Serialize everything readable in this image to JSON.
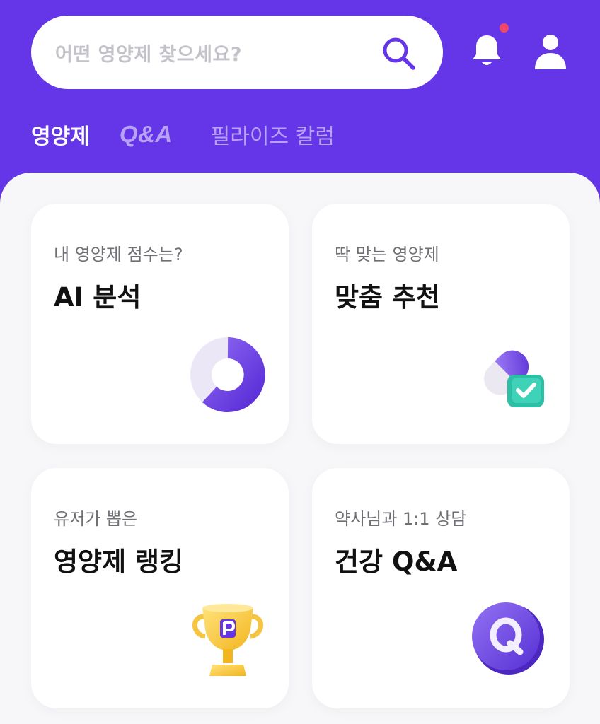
{
  "search": {
    "placeholder": "어떤 영양제 찾으세요?"
  },
  "header_icons": [
    "search-icon",
    "bell-icon",
    "user-icon"
  ],
  "tabs": [
    {
      "label": "영양제",
      "active": true
    },
    {
      "label": "Q&A",
      "active": false
    },
    {
      "label": "필라이즈 칼럼",
      "active": false
    }
  ],
  "cards": [
    {
      "sub": "내 영양제 점수는?",
      "title": "AI 분석",
      "icon": "donut-chart-icon"
    },
    {
      "sub": "딱 맞는 영양제",
      "title": "맞춤 추천",
      "icon": "pill-check-icon"
    },
    {
      "sub": "유저가 뽑은",
      "title": "영양제 랭킹",
      "icon": "trophy-icon"
    },
    {
      "sub": "약사님과 1:1 상담",
      "title": "건강 Q&A",
      "icon": "q-coin-icon"
    }
  ],
  "colors": {
    "brand": "#6436e8",
    "tab_inactive": "#b9a2f5",
    "notification_dot": "#f0466a"
  }
}
